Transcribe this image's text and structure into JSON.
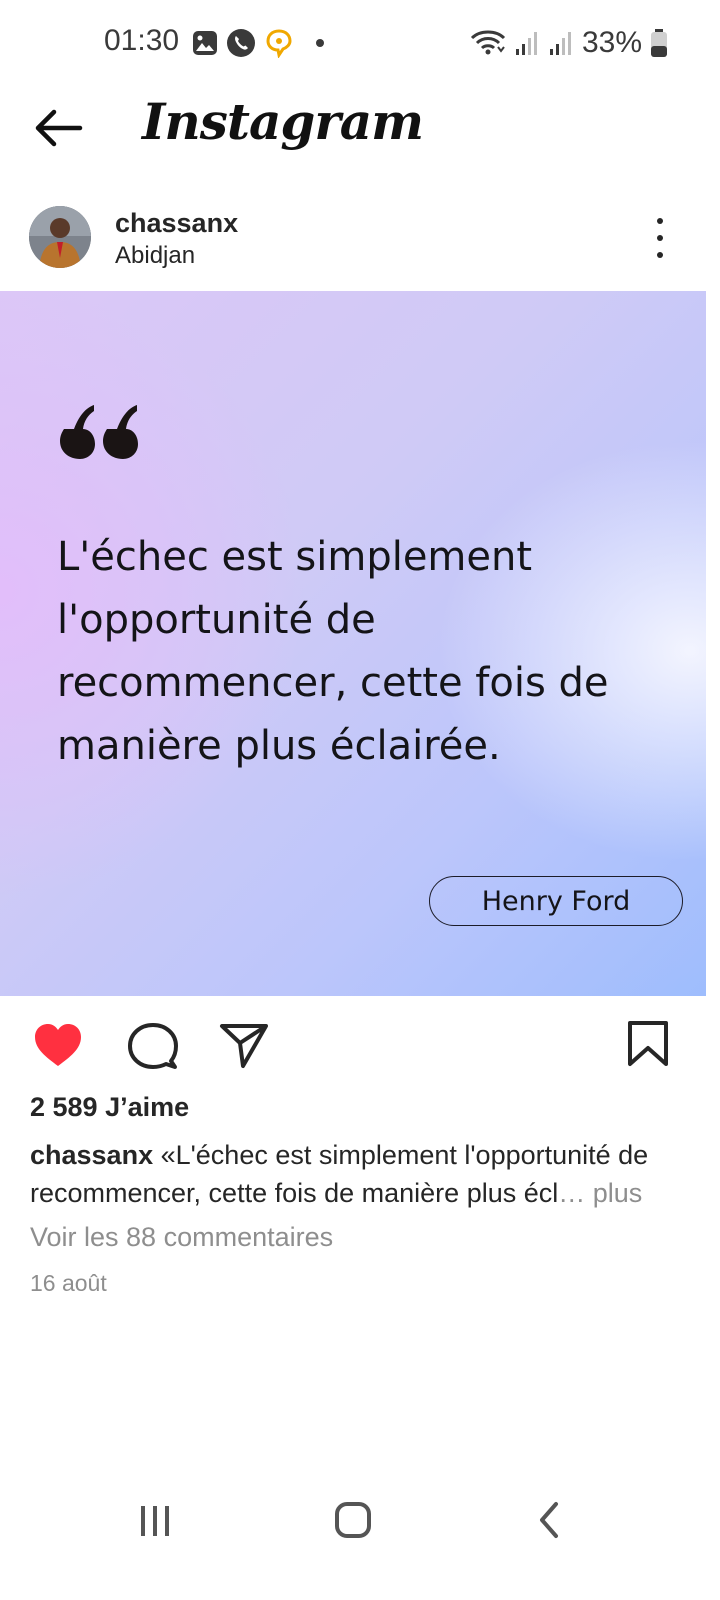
{
  "status_bar": {
    "time": "01:30",
    "battery": "33%",
    "icons": [
      "gallery-icon",
      "phone-icon",
      "chat-bubble-icon",
      "wifi-icon",
      "signal-icon",
      "battery-icon"
    ]
  },
  "header": {
    "logo": "Instagram"
  },
  "post": {
    "username": "chassanx",
    "location": "Abidjan",
    "quote_text": "L'échec est simplement l'opportunité de recommencer, cette fois de manière plus éclairée.",
    "author": "Henry Ford",
    "likes": "2 589 J’aime",
    "caption_user": "chassanx",
    "caption_text": " «L'échec est simplement l'opportunité de recommencer, cette fois de manière plus écl",
    "caption_more": "… plus",
    "comments_link": "Voir les 88 commentaires",
    "date": "16 août"
  },
  "colors": {
    "like_red": "#ff3040",
    "text": "#262626",
    "muted": "#8e8e8e"
  }
}
